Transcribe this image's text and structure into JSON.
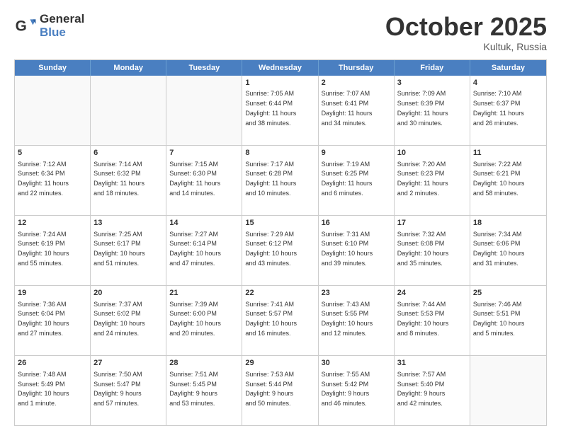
{
  "logo": {
    "general": "General",
    "blue": "Blue"
  },
  "title": "October 2025",
  "location": "Kultuk, Russia",
  "days": [
    "Sunday",
    "Monday",
    "Tuesday",
    "Wednesday",
    "Thursday",
    "Friday",
    "Saturday"
  ],
  "weeks": [
    [
      {
        "day": "",
        "info": ""
      },
      {
        "day": "",
        "info": ""
      },
      {
        "day": "",
        "info": ""
      },
      {
        "day": "1",
        "info": "Sunrise: 7:05 AM\nSunset: 6:44 PM\nDaylight: 11 hours\nand 38 minutes."
      },
      {
        "day": "2",
        "info": "Sunrise: 7:07 AM\nSunset: 6:41 PM\nDaylight: 11 hours\nand 34 minutes."
      },
      {
        "day": "3",
        "info": "Sunrise: 7:09 AM\nSunset: 6:39 PM\nDaylight: 11 hours\nand 30 minutes."
      },
      {
        "day": "4",
        "info": "Sunrise: 7:10 AM\nSunset: 6:37 PM\nDaylight: 11 hours\nand 26 minutes."
      }
    ],
    [
      {
        "day": "5",
        "info": "Sunrise: 7:12 AM\nSunset: 6:34 PM\nDaylight: 11 hours\nand 22 minutes."
      },
      {
        "day": "6",
        "info": "Sunrise: 7:14 AM\nSunset: 6:32 PM\nDaylight: 11 hours\nand 18 minutes."
      },
      {
        "day": "7",
        "info": "Sunrise: 7:15 AM\nSunset: 6:30 PM\nDaylight: 11 hours\nand 14 minutes."
      },
      {
        "day": "8",
        "info": "Sunrise: 7:17 AM\nSunset: 6:28 PM\nDaylight: 11 hours\nand 10 minutes."
      },
      {
        "day": "9",
        "info": "Sunrise: 7:19 AM\nSunset: 6:25 PM\nDaylight: 11 hours\nand 6 minutes."
      },
      {
        "day": "10",
        "info": "Sunrise: 7:20 AM\nSunset: 6:23 PM\nDaylight: 11 hours\nand 2 minutes."
      },
      {
        "day": "11",
        "info": "Sunrise: 7:22 AM\nSunset: 6:21 PM\nDaylight: 10 hours\nand 58 minutes."
      }
    ],
    [
      {
        "day": "12",
        "info": "Sunrise: 7:24 AM\nSunset: 6:19 PM\nDaylight: 10 hours\nand 55 minutes."
      },
      {
        "day": "13",
        "info": "Sunrise: 7:25 AM\nSunset: 6:17 PM\nDaylight: 10 hours\nand 51 minutes."
      },
      {
        "day": "14",
        "info": "Sunrise: 7:27 AM\nSunset: 6:14 PM\nDaylight: 10 hours\nand 47 minutes."
      },
      {
        "day": "15",
        "info": "Sunrise: 7:29 AM\nSunset: 6:12 PM\nDaylight: 10 hours\nand 43 minutes."
      },
      {
        "day": "16",
        "info": "Sunrise: 7:31 AM\nSunset: 6:10 PM\nDaylight: 10 hours\nand 39 minutes."
      },
      {
        "day": "17",
        "info": "Sunrise: 7:32 AM\nSunset: 6:08 PM\nDaylight: 10 hours\nand 35 minutes."
      },
      {
        "day": "18",
        "info": "Sunrise: 7:34 AM\nSunset: 6:06 PM\nDaylight: 10 hours\nand 31 minutes."
      }
    ],
    [
      {
        "day": "19",
        "info": "Sunrise: 7:36 AM\nSunset: 6:04 PM\nDaylight: 10 hours\nand 27 minutes."
      },
      {
        "day": "20",
        "info": "Sunrise: 7:37 AM\nSunset: 6:02 PM\nDaylight: 10 hours\nand 24 minutes."
      },
      {
        "day": "21",
        "info": "Sunrise: 7:39 AM\nSunset: 6:00 PM\nDaylight: 10 hours\nand 20 minutes."
      },
      {
        "day": "22",
        "info": "Sunrise: 7:41 AM\nSunset: 5:57 PM\nDaylight: 10 hours\nand 16 minutes."
      },
      {
        "day": "23",
        "info": "Sunrise: 7:43 AM\nSunset: 5:55 PM\nDaylight: 10 hours\nand 12 minutes."
      },
      {
        "day": "24",
        "info": "Sunrise: 7:44 AM\nSunset: 5:53 PM\nDaylight: 10 hours\nand 8 minutes."
      },
      {
        "day": "25",
        "info": "Sunrise: 7:46 AM\nSunset: 5:51 PM\nDaylight: 10 hours\nand 5 minutes."
      }
    ],
    [
      {
        "day": "26",
        "info": "Sunrise: 7:48 AM\nSunset: 5:49 PM\nDaylight: 10 hours\nand 1 minute."
      },
      {
        "day": "27",
        "info": "Sunrise: 7:50 AM\nSunset: 5:47 PM\nDaylight: 9 hours\nand 57 minutes."
      },
      {
        "day": "28",
        "info": "Sunrise: 7:51 AM\nSunset: 5:45 PM\nDaylight: 9 hours\nand 53 minutes."
      },
      {
        "day": "29",
        "info": "Sunrise: 7:53 AM\nSunset: 5:44 PM\nDaylight: 9 hours\nand 50 minutes."
      },
      {
        "day": "30",
        "info": "Sunrise: 7:55 AM\nSunset: 5:42 PM\nDaylight: 9 hours\nand 46 minutes."
      },
      {
        "day": "31",
        "info": "Sunrise: 7:57 AM\nSunset: 5:40 PM\nDaylight: 9 hours\nand 42 minutes."
      },
      {
        "day": "",
        "info": ""
      }
    ]
  ]
}
